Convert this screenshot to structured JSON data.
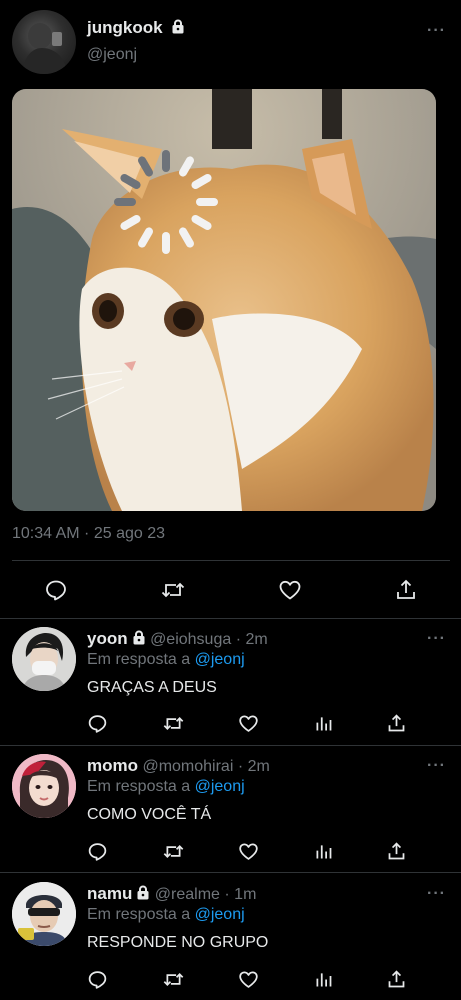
{
  "main_tweet": {
    "name": "jungkook",
    "handle": "@jeonj",
    "timestamp": "10:34 AM · 25 ago 23",
    "more": "···"
  },
  "replies": [
    {
      "name": "yoon",
      "locked": true,
      "handle": "@eiohsuga",
      "time": "· 2m",
      "reply_prefix": "Em resposta a",
      "reply_to": "@jeonj",
      "text": "GRAÇAS A DEUS"
    },
    {
      "name": "momo",
      "locked": false,
      "handle": "@momohirai",
      "time": "· 2m",
      "reply_prefix": "Em resposta a",
      "reply_to": "@jeonj",
      "text": "COMO VOCÊ TÁ"
    },
    {
      "name": "namu",
      "locked": true,
      "handle": "@realme",
      "time": "· 1m",
      "reply_prefix": "Em resposta a",
      "reply_to": "@jeonj",
      "text": "RESPONDE NO GRUPO"
    }
  ],
  "more_label": "···",
  "colors": {
    "background": "#000000",
    "text": "#e7e9ea",
    "muted": "#71767b",
    "link": "#1d9bf0",
    "divider": "#2f3336"
  }
}
